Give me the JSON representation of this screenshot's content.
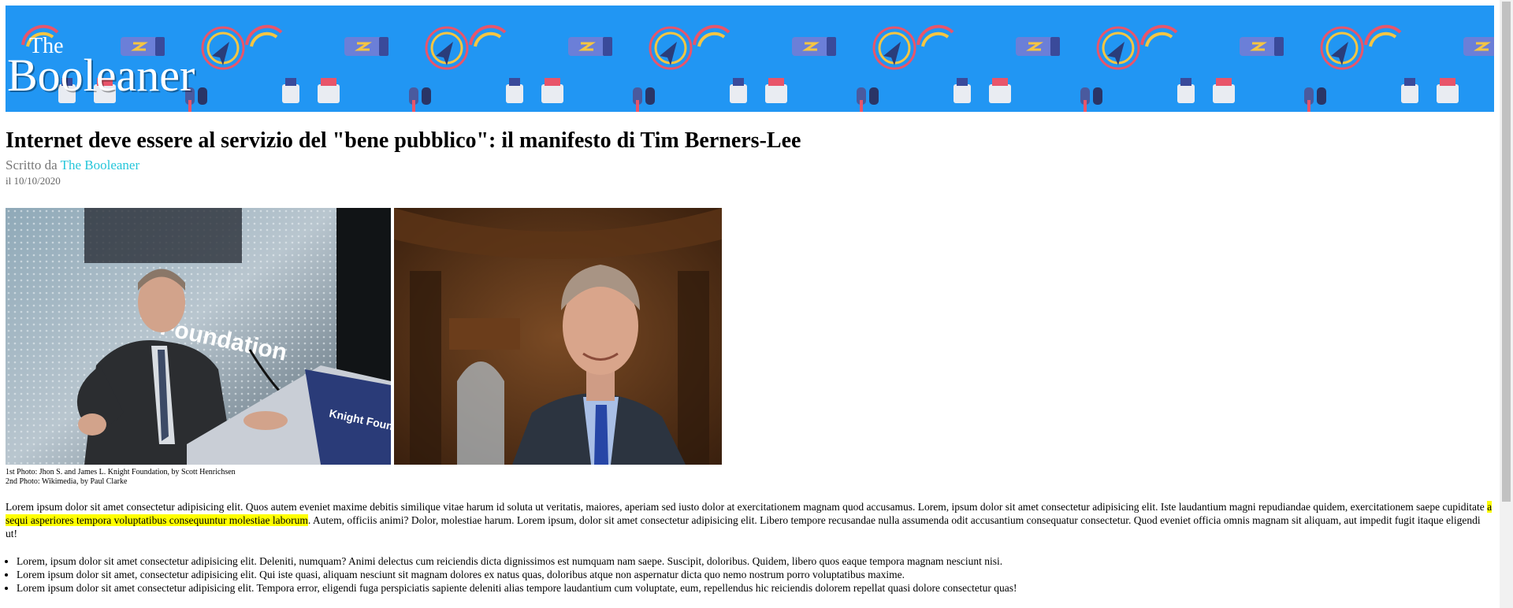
{
  "header": {
    "logo_small": "The",
    "logo_large": "Booleaner",
    "banner_color": "#2196f3",
    "pattern_icons": [
      "signal-icon",
      "battery-icon",
      "earphones-icon",
      "headphones-icon"
    ]
  },
  "article": {
    "title": "Internet deve essere al servizio del \"bene pubblico\": il manifesto di Tim Berners-Lee",
    "byline_prefix": "Scritto da",
    "author": "The Booleaner",
    "date": "il 10/10/2020",
    "photo_credit_1": "1st Photo: Jhon S. and James L. Knight Foundation, by Scott Henrichsen",
    "photo_credit_2": "2nd Photo: Wikimedia, by Paul Clarke",
    "paragraph_before": "Lorem ipsum dolor sit amet consectetur adipisicing elit. Quos autem eveniet maxime debitis similique vitae harum id soluta ut veritatis, maiores, aperiam sed iusto dolor at exercitationem magnam quod accusamus. Lorem, ipsum dolor sit amet consectetur adipisicing elit. Iste laudantium magni repudiandae quidem, exercitationem saepe cupiditate ",
    "paragraph_highlight": "a sequi asperiores tempora voluptatibus consequuntur molestiae laborum",
    "paragraph_after": ". Autem, officiis animi? Dolor, molestiae harum. Lorem ipsum, dolor sit amet consectetur adipisicing elit. Libero tempore recusandae nulla assumenda odit accusantium consequatur consectetur. Quod eveniet officia omnis magnam sit aliquam, aut impedit fugit itaque eligendi ut!",
    "bullets": [
      "Lorem, ipsum dolor sit amet consectetur adipisicing elit. Deleniti, numquam? Animi delectus cum reiciendis dicta dignissimos est numquam nam saepe. Suscipit, doloribus. Quidem, libero quos eaque tempora magnam nesciunt nisi.",
      "Lorem ipsum dolor sit amet, consectetur adipisicing elit. Qui iste quasi, aliquam nesciunt sit magnam dolores ex natus quas, doloribus atque non aspernatur dicta quo nemo nostrum porro voluptatibus maxime.",
      "Lorem ipsum dolor sit amet consectetur adipisicing elit. Tempora error, eligendi fuga perspiciatis sapiente deleniti alias tempore laudantium cum voluptate, eum, repellendus hic reiciendis dolorem repellat quasi dolore consectetur quas!"
    ],
    "podium_sign": "Knight Foundation",
    "backdrop_sign": "Foundation",
    "highlight_color": "#ffff00",
    "author_link_color": "#26c6da"
  }
}
